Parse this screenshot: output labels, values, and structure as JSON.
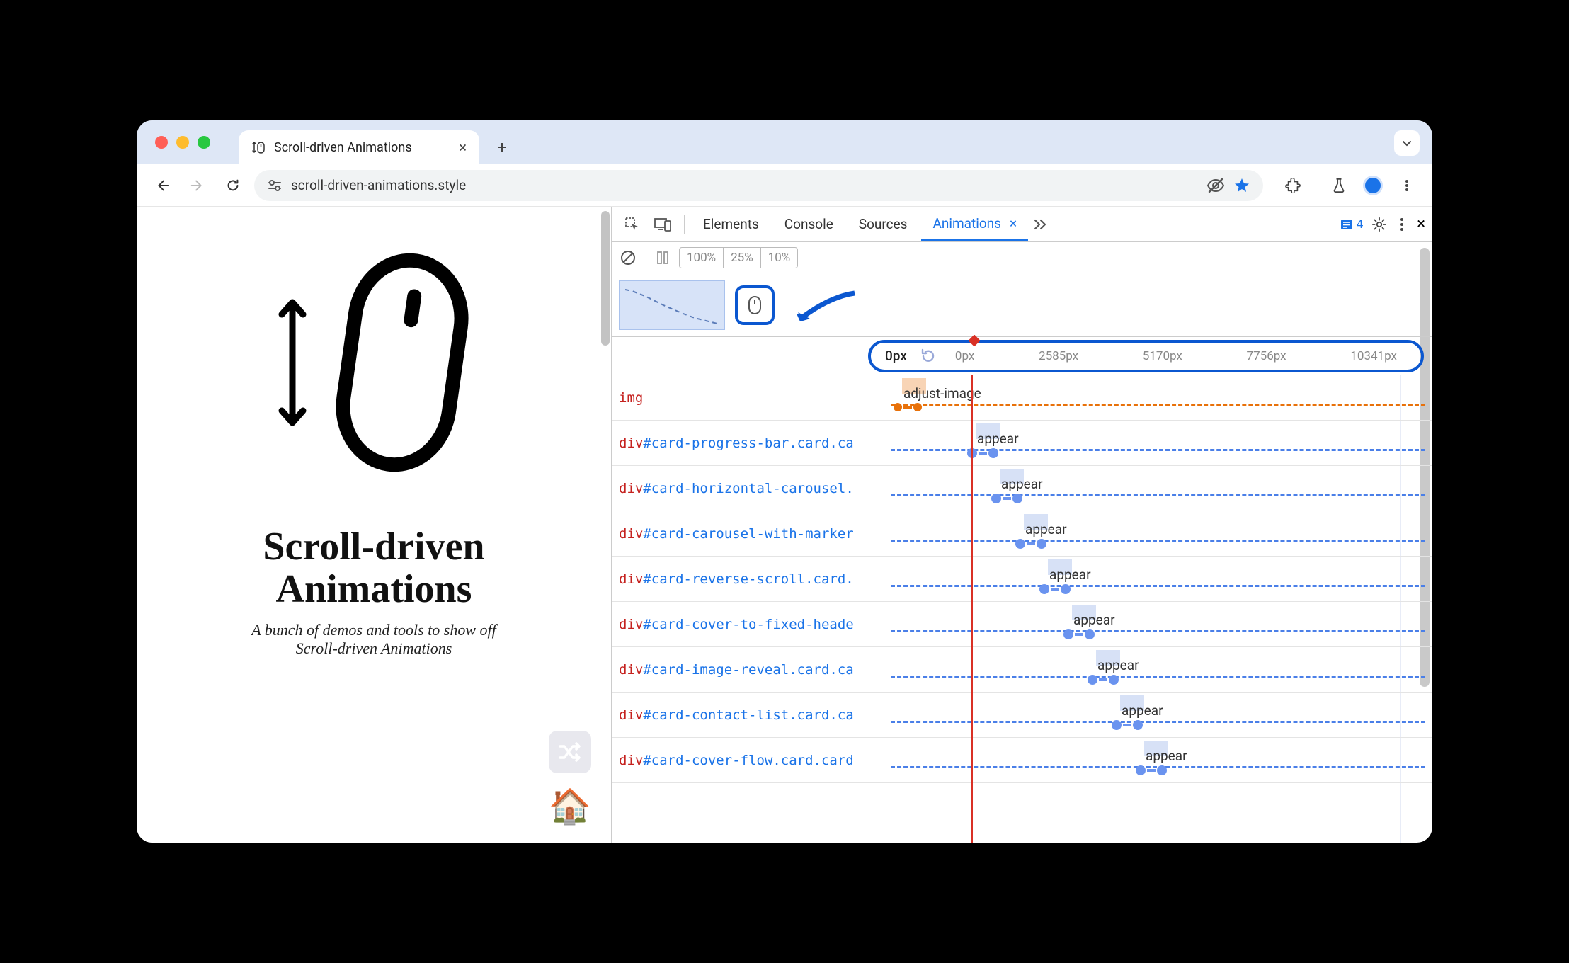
{
  "browser": {
    "tab": {
      "title": "Scroll-driven Animations",
      "favicon": "↕🖱"
    },
    "url": "scroll-driven-animations.style"
  },
  "page": {
    "title_line1": "Scroll-driven",
    "title_line2": "Animations",
    "subtitle_line1": "A bunch of demos and tools to show off",
    "subtitle_line2": "Scroll-driven Animations"
  },
  "devtools": {
    "tabs": {
      "elements": "Elements",
      "console": "Console",
      "sources": "Sources",
      "animations": "Animations"
    },
    "issues_count": "4",
    "playback": {
      "speed_100": "100%",
      "speed_25": "25%",
      "speed_10": "10%"
    },
    "ruler": {
      "current": "0px",
      "ticks": [
        "0px",
        "2585px",
        "5170px",
        "7756px",
        "10341px"
      ]
    },
    "tracks": [
      {
        "tag": "img",
        "sel": "",
        "anim": "adjust-image",
        "offset": 4,
        "type": "img"
      },
      {
        "tag": "div",
        "sel": "#card-progress-bar",
        "cls": ".card.ca",
        "anim": "appear",
        "offset": 108
      },
      {
        "tag": "div",
        "sel": "#card-horizontal-carousel",
        "cls": ".",
        "anim": "appear",
        "offset": 142
      },
      {
        "tag": "div",
        "sel": "#card-carousel-with-marker",
        "cls": "",
        "anim": "appear",
        "offset": 176
      },
      {
        "tag": "div",
        "sel": "#card-reverse-scroll",
        "cls": ".card.",
        "anim": "appear",
        "offset": 210
      },
      {
        "tag": "div",
        "sel": "#card-cover-to-fixed-heade",
        "cls": "",
        "anim": "appear",
        "offset": 244
      },
      {
        "tag": "div",
        "sel": "#card-image-reveal",
        "cls": ".card.ca",
        "anim": "appear",
        "offset": 278
      },
      {
        "tag": "div",
        "sel": "#card-contact-list",
        "cls": ".card.ca",
        "anim": "appear",
        "offset": 312
      },
      {
        "tag": "div",
        "sel": "#card-cover-flow",
        "cls": ".card.card",
        "anim": "appear",
        "offset": 346
      }
    ]
  }
}
